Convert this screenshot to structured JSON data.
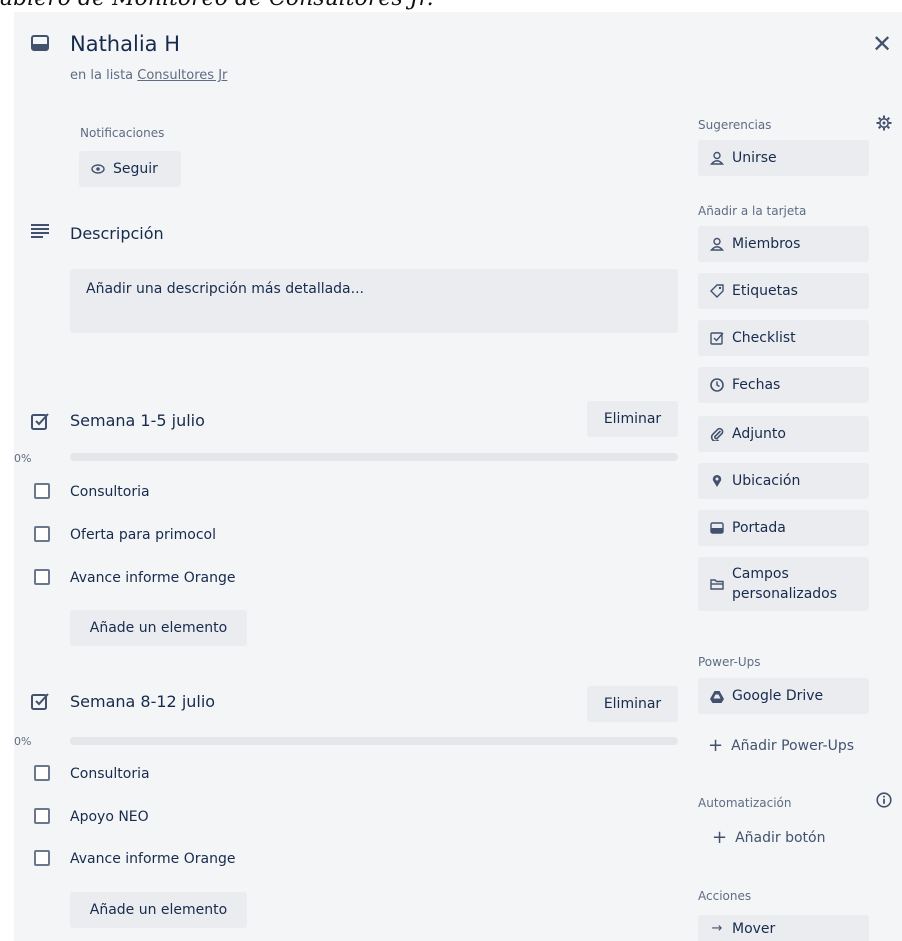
{
  "top_caption": "ablero de Monitoreo de Consultores Jr.",
  "card": {
    "title": "Nathalia H",
    "in_list_prefix": "en la lista",
    "list_name": "Consultores Jr"
  },
  "notifications": {
    "label": "Notificaciones",
    "follow_button": "Seguir"
  },
  "description": {
    "title": "Descripción",
    "placeholder": "Añadir una descripción más detallada..."
  },
  "checklists": [
    {
      "title": "Semana 1-5 julio",
      "delete_label": "Eliminar",
      "percent_label": "0%",
      "progress": 0,
      "items": [
        {
          "text": "Consultoria",
          "checked": false
        },
        {
          "text": "Oferta para primocol",
          "checked": false
        },
        {
          "text": "Avance informe Orange",
          "checked": false
        }
      ],
      "add_item_label": "Añade un elemento"
    },
    {
      "title": "Semana 8-12 julio",
      "delete_label": "Eliminar",
      "percent_label": "0%",
      "progress": 0,
      "items": [
        {
          "text": "Consultoria",
          "checked": false
        },
        {
          "text": "Apoyo NEO",
          "checked": false
        },
        {
          "text": "Avance informe Orange",
          "checked": false
        }
      ],
      "add_item_label": "Añade un elemento"
    }
  ],
  "sidebar": {
    "suggestions_label": "Sugerencias",
    "join_button": "Unirse",
    "add_to_card_label": "Añadir a la tarjeta",
    "add_to_card_buttons": [
      "Miembros",
      "Etiquetas",
      "Checklist",
      "Fechas",
      "Adjunto",
      "Ubicación",
      "Portada",
      "Campos personalizados"
    ],
    "powerups_label": "Power-Ups",
    "google_drive_button": "Google Drive",
    "add_powerups_link": "Añadir Power-Ups",
    "automation_label": "Automatización",
    "add_button_link": "Añadir botón",
    "actions_label": "Acciones",
    "move_button": "Mover"
  },
  "colors": {
    "modal_bg": "#f4f5f7",
    "button_bg": "#ebecf0",
    "text": "#172b4d",
    "muted": "#5e6c84"
  }
}
